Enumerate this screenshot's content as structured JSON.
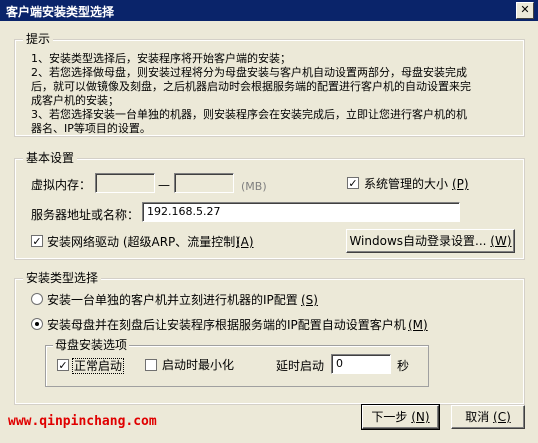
{
  "window": {
    "title": "客户端安装类型选择",
    "close_symbol": "✕"
  },
  "tips": {
    "title": "提示",
    "lines": [
      "1、安装类型选择后，安装程序将开始客户端的安装；",
      "2、若您选择做母盘，则安装过程将分为母盘安装与客户机自动设置两部分，母盘安装完成",
      "后，就可以做镜像及刻盘，之后机器启动时会根据服务端的配置进行客户机的自动设置来完",
      "成客户机的安装；",
      "3、若您选择安装一台单独的机器，则安装程序会在安装完成后，立即让您进行客户机的机",
      "器名、IP等项目的设置。"
    ]
  },
  "basic": {
    "title": "基本设置",
    "vmem_label": "虚拟内存：",
    "vmem_min": "",
    "vmem_dash": "—",
    "vmem_max": "",
    "vmem_unit": "(MB)",
    "sys_managed_label": "系统管理的大小",
    "sys_managed_key": "(P)",
    "server_label": "服务器地址或名称：",
    "server_value": "192.168.5.27",
    "netdrv_label": "安装网络驱动 (超级ARP、流量控制)",
    "netdrv_key": "(A)",
    "autologin_button": "Windows自动登录设置...",
    "autologin_key": "(W)"
  },
  "install_type": {
    "title": "安装类型选择",
    "option1": "安装一台单独的客户机并立刻进行机器的IP配置",
    "option1_key": "(S)",
    "option2": "安装母盘并在刻盘后让安装程序根据服务端的IP配置自动设置客户机",
    "option2_key": "(M)",
    "master": {
      "title": "母盘安装选项",
      "normal_start": "正常启动",
      "minimize_start": "启动时最小化",
      "delay_label": "延时启动",
      "delay_value": "0",
      "delay_unit": "秒"
    }
  },
  "footer": {
    "watermark": "www.qinpinchang.com",
    "next_label": "下一步",
    "next_key": "(N)",
    "cancel_label": "取消",
    "cancel_key": "(C)"
  }
}
